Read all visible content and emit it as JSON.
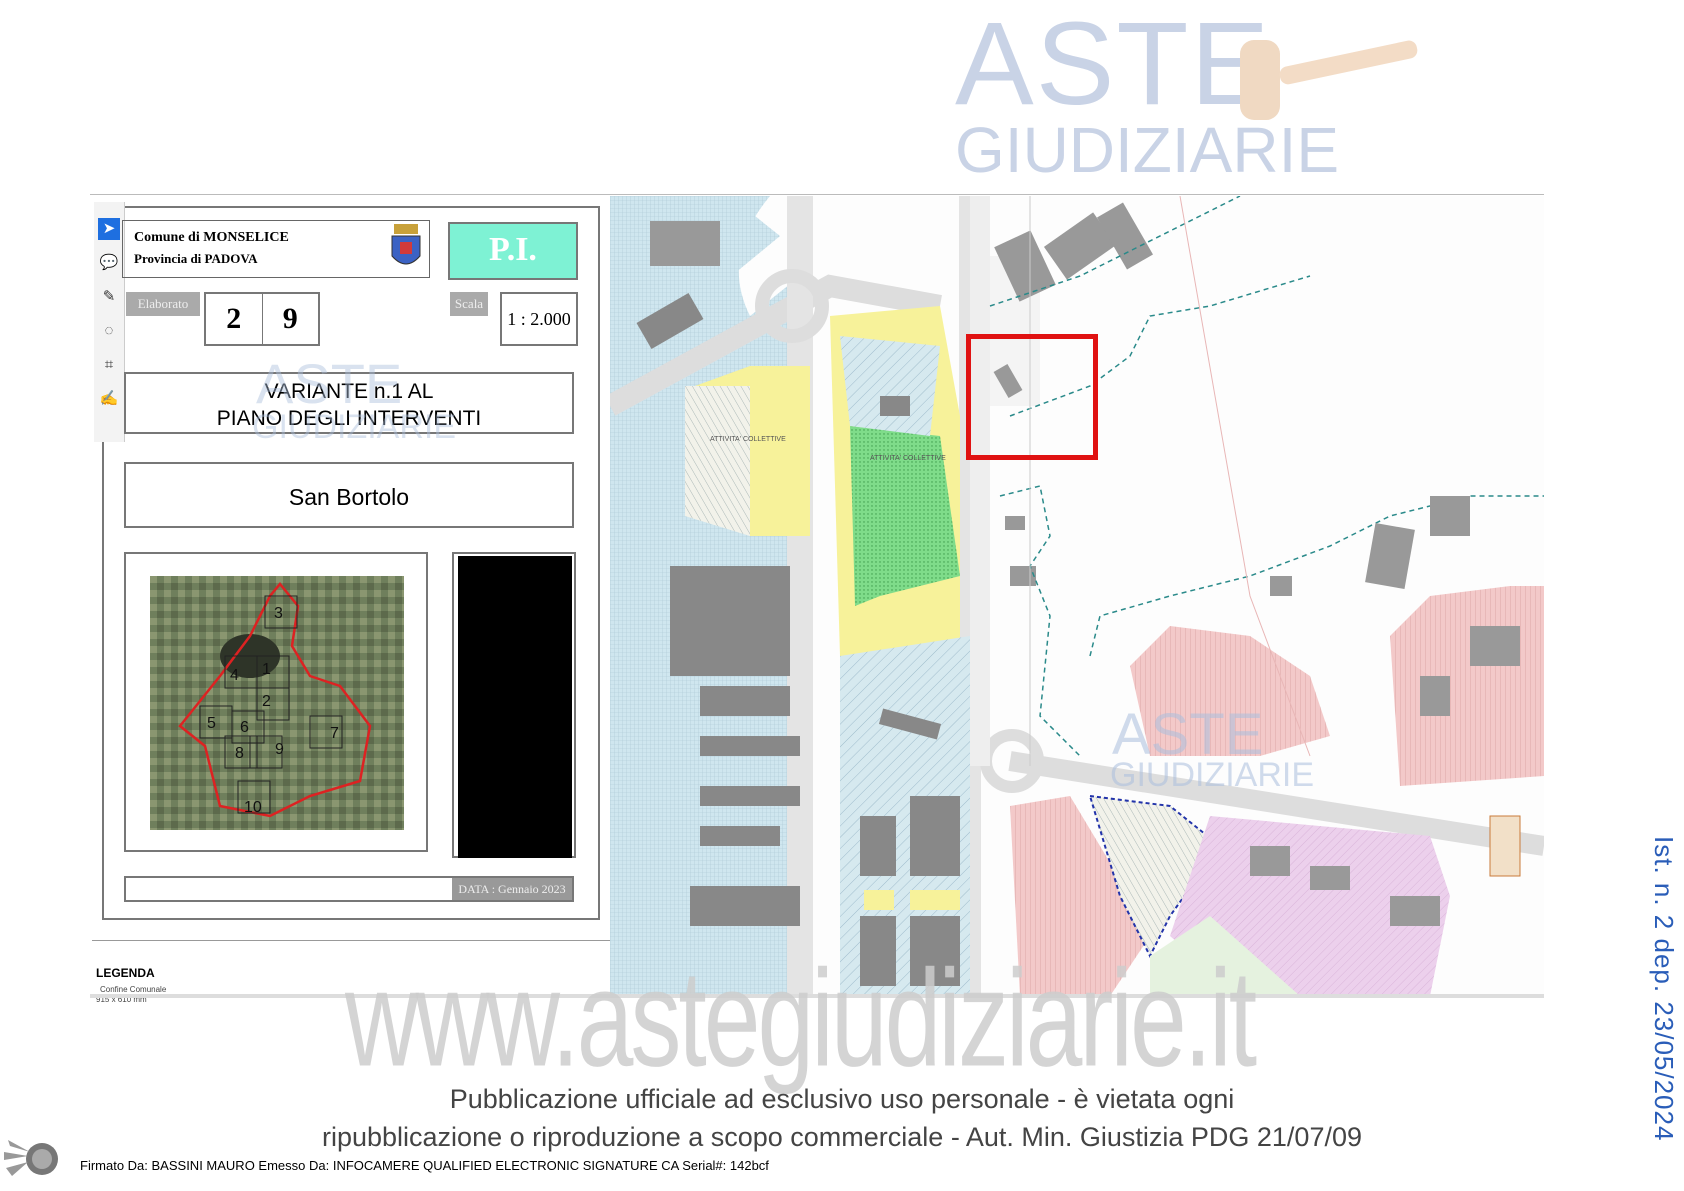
{
  "watermark": {
    "top_line": "ASTE",
    "bottom_line": "GIUDIZIARIE",
    "site": "www.astegiudiziarie.it"
  },
  "titleblock": {
    "comune": "Comune di MONSELICE",
    "provincia": "Provincia  di  PADOVA",
    "pi": "P.I.",
    "elaborato_label": "Elaborato",
    "elaborato_1": "2",
    "elaborato_2": "9",
    "scala_label": "Scala",
    "scala_value": "1 : 2.000",
    "variante_line1": "VARIANTE n.1 AL",
    "variante_line2": "PIANO DEGLI INTERVENTI",
    "localita": "San Bortolo",
    "data_label": "DATA : Gennaio 2023"
  },
  "mini_map": {
    "sheets": [
      "3",
      "4",
      "1",
      "2",
      "5",
      "6",
      "7",
      "8",
      "9",
      "10"
    ]
  },
  "legend": {
    "title": "LEGENDA",
    "item": "Confine Comunale",
    "dimensions": "915 x 610 mm"
  },
  "map_labels": {
    "attivita_1": "ATTIVITA' COLLETTIVE",
    "attivita_2": "ATTIVITA' COLLETTIVE"
  },
  "colors": {
    "highlight": "#e01212",
    "pi_bg": "#7ef2d4",
    "side_text": "#2a5db8",
    "blue_zone": "#cfe6ef",
    "yellow_zone": "#f7f29a",
    "green_zone": "#7fdc8a",
    "pink_zone": "#f3c9c9",
    "violet_zone": "#ecd0ec"
  },
  "footer": {
    "line1": "Pubblicazione ufficiale ad esclusivo uso personale - è vietata ogni",
    "line2": "ripubblicazione o riproduzione a scopo commerciale - Aut. Min. Giustizia PDG 21/07/09",
    "signature": "Firmato Da: BASSINI MAURO Emesso Da: INFOCAMERE QUALIFIED ELECTRONIC SIGNATURE CA Serial#: 142bcf"
  },
  "side_text": "Ist. n. 2 dep. 23/05/2024",
  "toolbar_icons": [
    "select-icon",
    "comment-icon",
    "pen-icon",
    "lasso-icon",
    "text-recognition-icon",
    "sign-icon"
  ]
}
